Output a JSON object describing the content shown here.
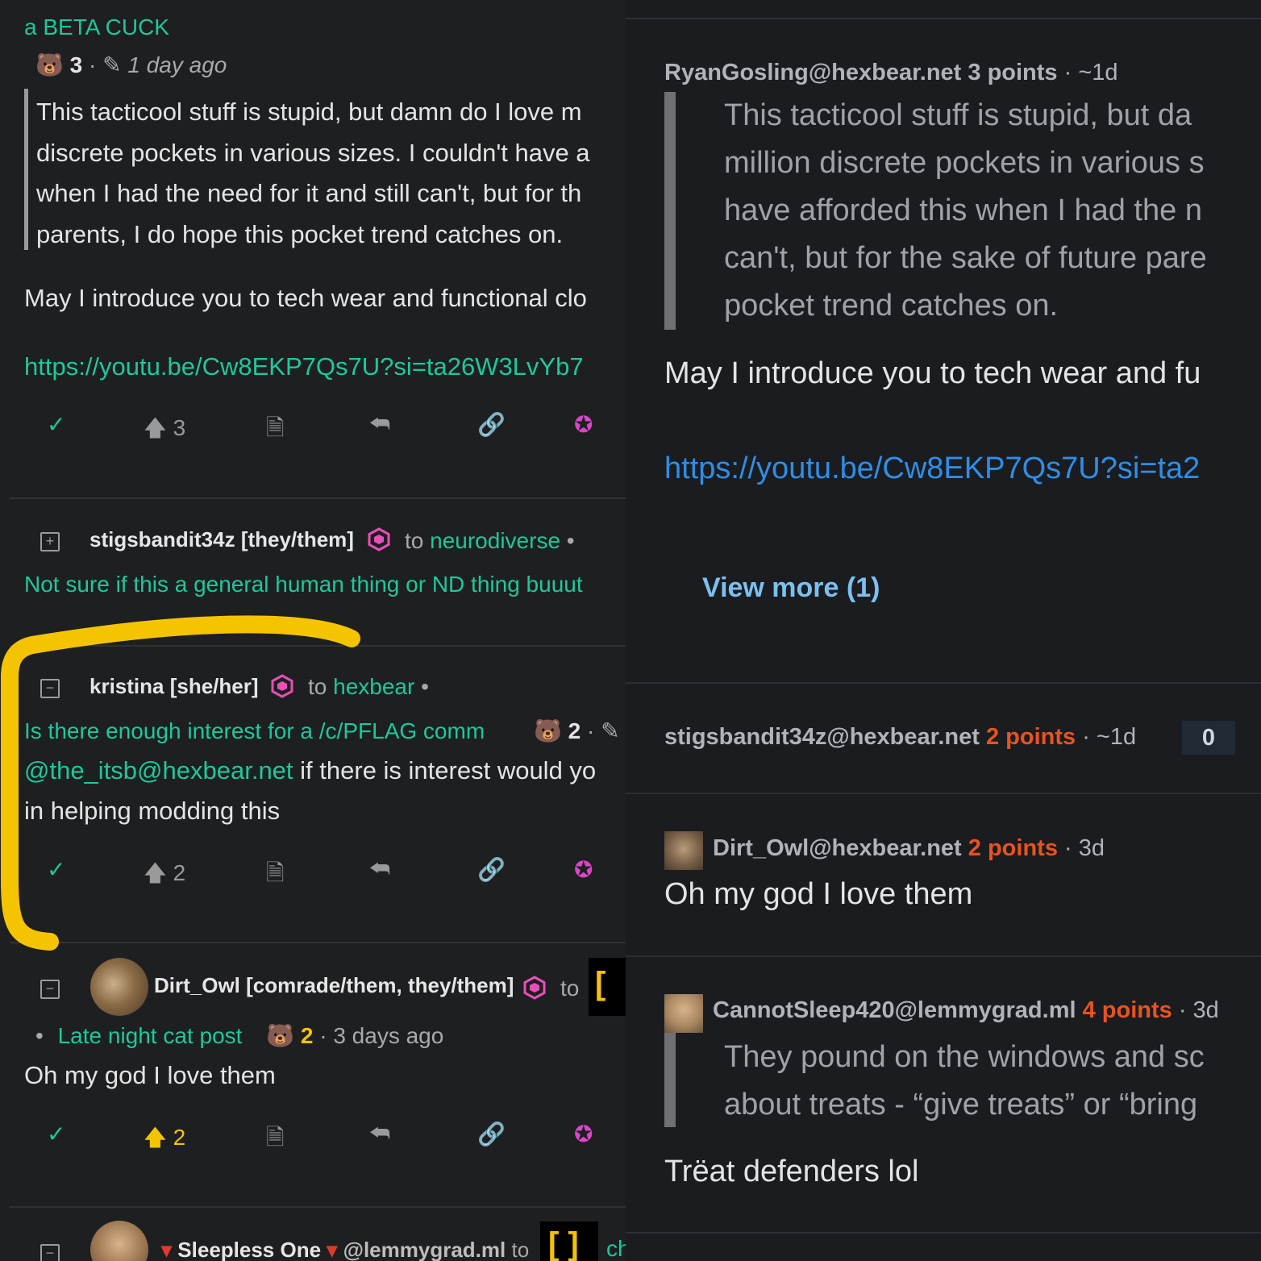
{
  "left": {
    "top_text": "a BETA CUCK",
    "c1": {
      "score": "3",
      "age": "1 day ago",
      "quote_lines": [
        "This tacticool stuff is stupid, but damn do I love m",
        "discrete pockets in various sizes. I couldn't have a",
        "when I had the need for it and still can't, but for th",
        "parents, I do hope this pocket trend catches on."
      ],
      "body": "May I introduce you to tech wear and functional clo",
      "link": "https://youtu.be/Cw8EKP7Qs7U?si=ta26W3LvYb7",
      "upvotes": "3"
    },
    "c2": {
      "user": "stigsbandit34z [they/them]",
      "to": "to",
      "community": "neurodiverse",
      "dot": "•",
      "post_title": "Not sure if this a general human thing or ND thing buuut"
    },
    "c3": {
      "user": "kristina [she/her]",
      "to": "to",
      "community": "hexbear",
      "dot": "•",
      "post_title": "Is there enough interest for a /c/PFLAG comm",
      "score": "2",
      "mention": "@the_itsb@hexbear.net",
      "body_rest": " if there is interest would yo",
      "body_line2": "in helping modding this",
      "upvotes": "2"
    },
    "c4": {
      "user": "Dirt_Owl [comrade/them, they/them]",
      "to": "to",
      "dot": "•",
      "post_title": "Late night cat post",
      "score": "2",
      "age": "3 days ago",
      "body": "Oh my god I love them",
      "upvotes": "2"
    },
    "c5": {
      "user": "Sleepless One",
      "instance": "@lemmygrad.ml",
      "to": "to",
      "community_frag": "ch"
    }
  },
  "right": {
    "c1": {
      "user": "RyanGosling@hexbear.net",
      "points": "3 points",
      "age": "· ~1d",
      "quote_lines": [
        "This tacticool stuff is stupid, but da",
        "million discrete pockets in various s",
        "have afforded this when I had the n",
        "can't, but for the sake of future pare",
        "pocket trend catches on."
      ],
      "body": "May I introduce you to tech wear and fu",
      "link": "https://youtu.be/Cw8EKP7Qs7U?si=ta2"
    },
    "view_more": "View more (1)",
    "c2": {
      "user": "stigsbandit34z@hexbear.net",
      "points": "2 points",
      "age": "· ~1d",
      "badge": "0"
    },
    "c3": {
      "user": "Dirt_Owl@hexbear.net",
      "points": "2 points",
      "age": "· 3d",
      "body": "Oh my god I love them"
    },
    "c4": {
      "user": "CannotSleep420@lemmygrad.ml",
      "points": "4 points",
      "age": "· 3d",
      "quote_lines": [
        "They pound on the windows and sc",
        "about treats - “give treats” or “bring"
      ],
      "body": "Trëat defenders lol"
    }
  },
  "colors": {
    "accent_green": "#1ec89a",
    "points_orange": "#e8541f",
    "link_blue": "#2f8ee6",
    "highlight_yellow": "#f5c400",
    "hex_pink": "#e84fb7"
  }
}
